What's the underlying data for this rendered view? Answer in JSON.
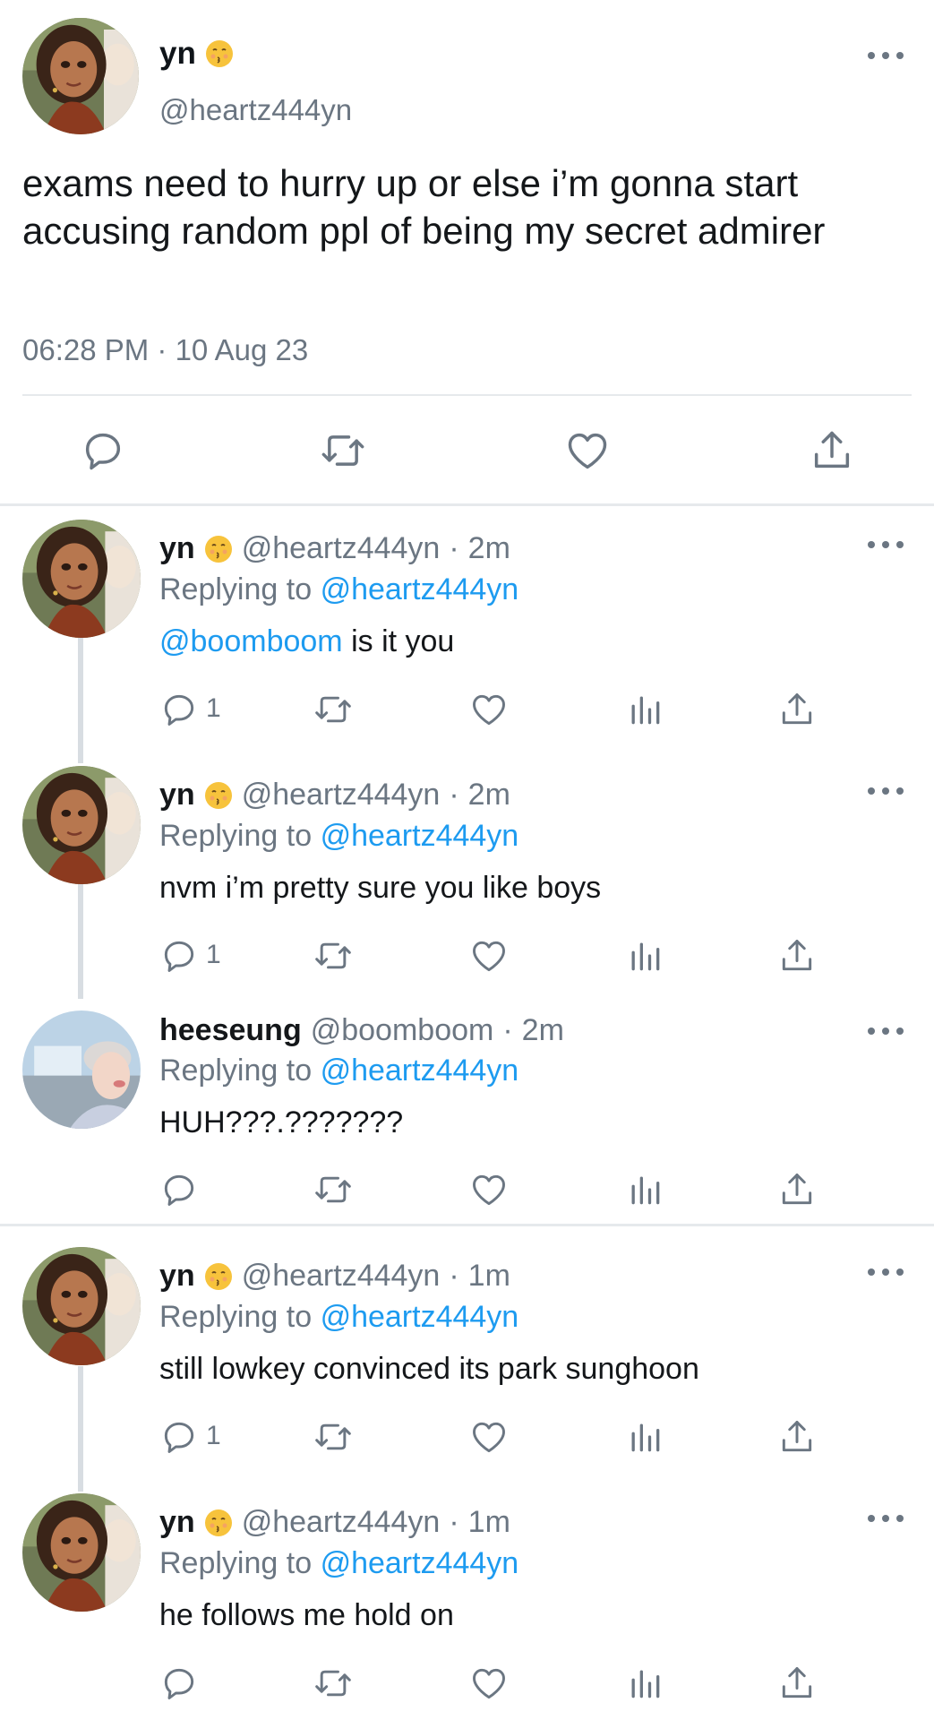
{
  "main_tweet": {
    "author_name": "yn",
    "author_emoji": "kissing-face-emoji",
    "author_handle": "@heartz444yn",
    "text": "exams need to hurry up or else i’m gonna start accusing random ppl of being my secret admirer",
    "timestamp": "06:28 PM · 10 Aug 23",
    "actions": [
      "reply-icon",
      "retweet-icon",
      "like-icon",
      "share-icon"
    ]
  },
  "replies": [
    {
      "name": "yn",
      "emoji": "kissing-face-emoji",
      "handle": "@heartz444yn",
      "sep": "·",
      "time": "2m",
      "replying_prefix": "Replying to",
      "replying_to": "@heartz444yn",
      "mention": "@boomboom",
      "text": " is it you",
      "reply_count": "1"
    },
    {
      "name": "yn",
      "emoji": "kissing-face-emoji",
      "handle": "@heartz444yn",
      "sep": "·",
      "time": "2m",
      "replying_prefix": "Replying to",
      "replying_to": "@heartz444yn",
      "text": "nvm i’m pretty sure you like boys",
      "reply_count": "1"
    },
    {
      "name": "heeseung",
      "handle": "@boomboom",
      "sep": "·",
      "time": "2m",
      "replying_prefix": "Replying to",
      "replying_to": "@heartz444yn",
      "text": "HUH???.???????",
      "reply_count": ""
    },
    {
      "name": "yn",
      "emoji": "kissing-face-emoji",
      "handle": "@heartz444yn",
      "sep": "·",
      "time": "1m",
      "replying_prefix": "Replying to",
      "replying_to": "@heartz444yn",
      "text": "still lowkey convinced its park sunghoon",
      "reply_count": "1"
    },
    {
      "name": "yn",
      "emoji": "kissing-face-emoji",
      "handle": "@heartz444yn",
      "sep": "·",
      "time": "1m",
      "replying_prefix": "Replying to",
      "replying_to": "@heartz444yn",
      "text": "he follows me hold on",
      "reply_count": ""
    }
  ],
  "reply_actions": [
    "reply-icon",
    "retweet-icon",
    "like-icon",
    "analytics-icon",
    "share-icon"
  ],
  "colors": {
    "link": "#1d9bf0",
    "secondary_text": "#6b7682",
    "divider": "#e6e9ec",
    "thread_line": "#d8dde2"
  }
}
